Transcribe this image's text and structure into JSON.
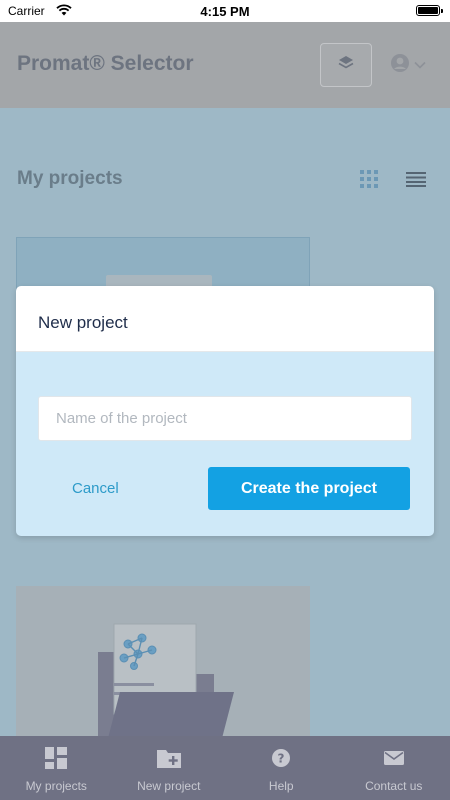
{
  "status_bar": {
    "carrier": "Carrier",
    "time": "4:15 PM",
    "battery_level": 1.0
  },
  "header": {
    "app_title": "Promat® Selector",
    "layers_button_icon": "layers-icon",
    "user_menu_icon": "user-circle-icon"
  },
  "main": {
    "section_title": "My projects",
    "view_toggles": [
      {
        "icon": "grid-view-icon"
      },
      {
        "icon": "list-view-icon"
      }
    ]
  },
  "modal": {
    "title": "New project",
    "name_placeholder": "Name of the project",
    "name_value": "",
    "cancel_label": "Cancel",
    "create_label": "Create the project"
  },
  "tab_bar": {
    "items": [
      {
        "label": "My projects",
        "icon": "dashboard-icon"
      },
      {
        "label": "New project",
        "icon": "folder-plus-icon"
      },
      {
        "label": "Help",
        "icon": "help-icon"
      },
      {
        "label": "Contact us",
        "icon": "mail-icon"
      }
    ]
  },
  "colors": {
    "primary": "#13a1e3",
    "overlay": "#9eb8c6",
    "modal_body": "#cfe9f8",
    "tab_bar": "#6f7184"
  }
}
